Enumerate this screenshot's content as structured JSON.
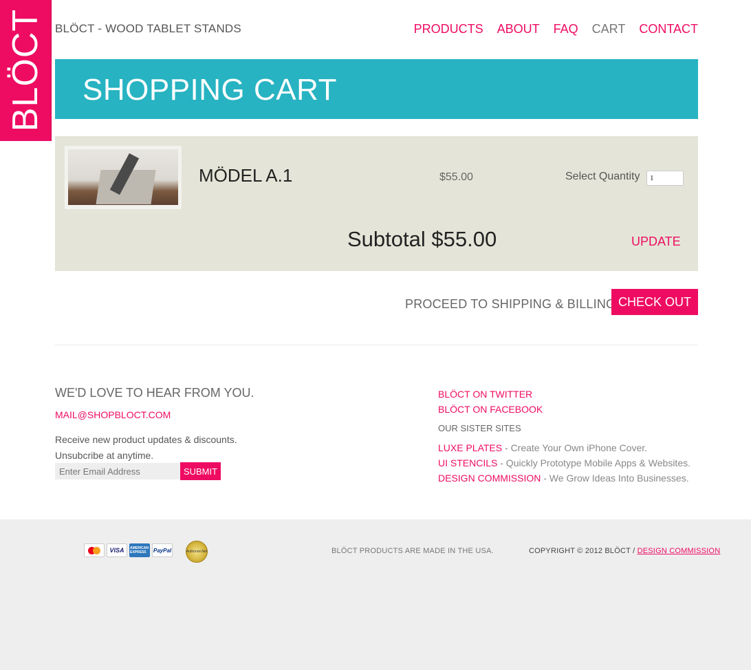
{
  "brand": {
    "logo": "BLÖCT",
    "site_title": "BLÖCT - WOOD TABLET STANDS",
    "accent": "#ee0c62",
    "banner_color": "#27b3c2"
  },
  "nav": {
    "items": [
      {
        "label": "PRODUCTS"
      },
      {
        "label": "ABOUT"
      },
      {
        "label": "FAQ"
      },
      {
        "label": "CART",
        "active": true
      },
      {
        "label": "CONTACT"
      }
    ]
  },
  "page": {
    "title": "SHOPPING CART"
  },
  "cart": {
    "item": {
      "name": "MÖDEL A.1",
      "price": "$55.00",
      "quantity_label": "Select Quantity",
      "quantity": "1"
    },
    "subtotal": "Subtotal $55.00",
    "update_label": "UPDATE",
    "proceed_text": "PROCEED TO SHIPPING & BILLING",
    "checkout_label": "CHECK OUT"
  },
  "contact": {
    "heading": "WE'D LOVE TO HEAR FROM YOU.",
    "email": "MAIL@SHOPBLOCT.COM",
    "updates_line1": "Receive new product updates & discounts.",
    "updates_line2": "Unsubcribe at anytime.",
    "email_placeholder": "Enter Email Address",
    "submit_label": "SUBMIT"
  },
  "social": {
    "twitter": "BLÖCT ON TWITTER",
    "facebook": "BLÖCT ON FACEBOOK"
  },
  "sister_sites": {
    "title": "OUR SISTER SITES",
    "items": [
      {
        "name": "LUXE PLATES",
        "desc": " - Create Your Own iPhone Cover."
      },
      {
        "name": "UI STENCILS",
        "desc": " - Quickly Prototype Mobile Apps & Websites."
      },
      {
        "name": "DESIGN COMMISSION",
        "desc": " - We Grow Ideas Into Businesses."
      }
    ]
  },
  "footer": {
    "cards": [
      "mastercard-icon",
      "visa-icon",
      "amex-icon",
      "paypal-icon"
    ],
    "card_labels": {
      "visa": "VISA",
      "amex": "AMERICAN EXPRESS",
      "paypal": "PayPal"
    },
    "seal_label": "Authorize.Net",
    "made_in": "BLÖCT PRODUCTS ARE MADE IN THE USA.",
    "copyright": "COPYRIGHT © 2012 BLÖCT / ",
    "copyright_link": "DESIGN COMMISSION"
  }
}
